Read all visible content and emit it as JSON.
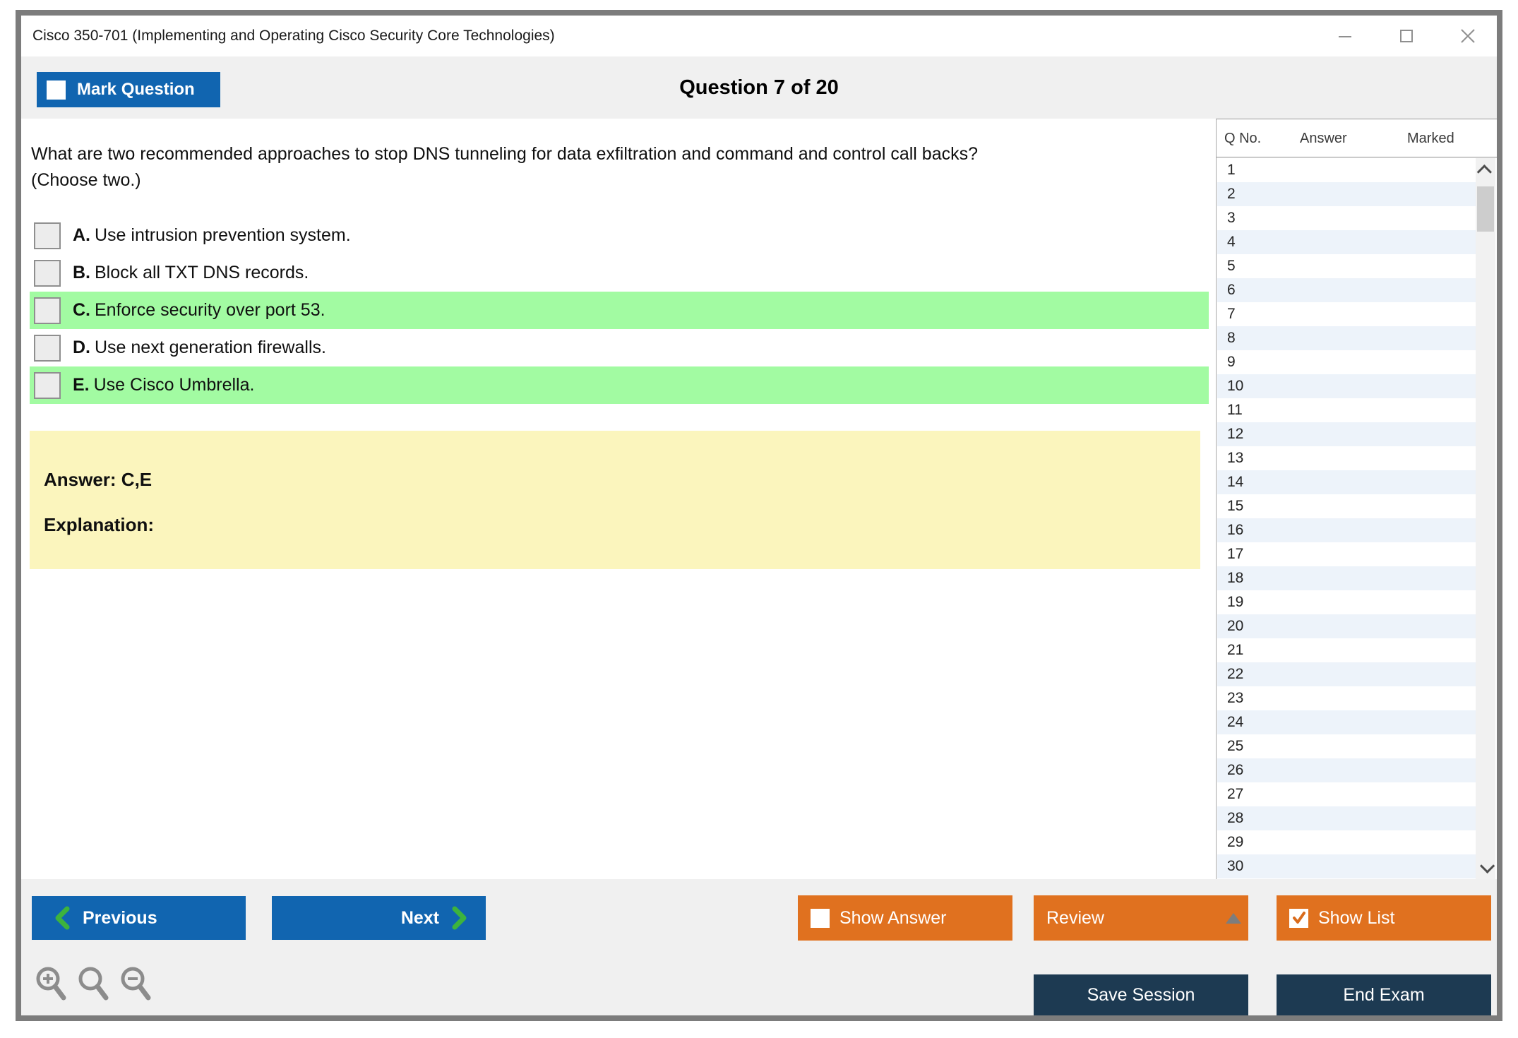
{
  "window": {
    "title": "Cisco 350-701 (Implementing and Operating Cisco Security Core Technologies)"
  },
  "header": {
    "mark_question_label": "Mark Question",
    "question_counter": "Question 7 of 20"
  },
  "question": {
    "line1": "What are two recommended approaches to stop DNS tunneling for data exfiltration and command and control call backs?",
    "line2": "(Choose two.)"
  },
  "options": [
    {
      "letter": "A.",
      "text": "Use intrusion prevention system.",
      "highlighted": false
    },
    {
      "letter": "B.",
      "text": "Block all TXT DNS records.",
      "highlighted": false
    },
    {
      "letter": "C.",
      "text": "Enforce security over port 53.",
      "highlighted": true
    },
    {
      "letter": "D.",
      "text": "Use next generation firewalls.",
      "highlighted": false
    },
    {
      "letter": "E.",
      "text": "Use Cisco Umbrella.",
      "highlighted": true
    }
  ],
  "answer_panel": {
    "answer_label": "Answer: C,E",
    "explanation_label": "Explanation:"
  },
  "sidebar": {
    "columns": {
      "qno": "Q No.",
      "answer": "Answer",
      "marked": "Marked"
    },
    "rows": [
      {
        "no": "1",
        "answer": "",
        "marked": ""
      },
      {
        "no": "2",
        "answer": "",
        "marked": ""
      },
      {
        "no": "3",
        "answer": "",
        "marked": ""
      },
      {
        "no": "4",
        "answer": "",
        "marked": ""
      },
      {
        "no": "5",
        "answer": "",
        "marked": ""
      },
      {
        "no": "6",
        "answer": "",
        "marked": ""
      },
      {
        "no": "7",
        "answer": "",
        "marked": ""
      },
      {
        "no": "8",
        "answer": "",
        "marked": ""
      },
      {
        "no": "9",
        "answer": "",
        "marked": ""
      },
      {
        "no": "10",
        "answer": "",
        "marked": ""
      },
      {
        "no": "11",
        "answer": "",
        "marked": ""
      },
      {
        "no": "12",
        "answer": "",
        "marked": ""
      },
      {
        "no": "13",
        "answer": "",
        "marked": ""
      },
      {
        "no": "14",
        "answer": "",
        "marked": ""
      },
      {
        "no": "15",
        "answer": "",
        "marked": ""
      },
      {
        "no": "16",
        "answer": "",
        "marked": ""
      },
      {
        "no": "17",
        "answer": "",
        "marked": ""
      },
      {
        "no": "18",
        "answer": "",
        "marked": ""
      },
      {
        "no": "19",
        "answer": "",
        "marked": ""
      },
      {
        "no": "20",
        "answer": "",
        "marked": ""
      },
      {
        "no": "21",
        "answer": "",
        "marked": ""
      },
      {
        "no": "22",
        "answer": "",
        "marked": ""
      },
      {
        "no": "23",
        "answer": "",
        "marked": ""
      },
      {
        "no": "24",
        "answer": "",
        "marked": ""
      },
      {
        "no": "25",
        "answer": "",
        "marked": ""
      },
      {
        "no": "26",
        "answer": "",
        "marked": ""
      },
      {
        "no": "27",
        "answer": "",
        "marked": ""
      },
      {
        "no": "28",
        "answer": "",
        "marked": ""
      },
      {
        "no": "29",
        "answer": "",
        "marked": ""
      },
      {
        "no": "30",
        "answer": "",
        "marked": ""
      }
    ]
  },
  "footer": {
    "previous_label": "Previous",
    "next_label": "Next",
    "show_answer_label": "Show Answer",
    "review_label": "Review",
    "show_list_label": "Show List",
    "save_session_label": "Save Session",
    "end_exam_label": "End Exam"
  },
  "colors": {
    "blue": "#1165b0",
    "orange": "#e0711f",
    "navy": "#1d3a52",
    "green_highlight": "#a2fba2",
    "yellow_panel": "#fbf5bd",
    "band_gray": "#f0f0f0",
    "row_alt": "#edf3fa",
    "window_border": "#7c7c7c",
    "chevron_green": "#3db33d"
  }
}
